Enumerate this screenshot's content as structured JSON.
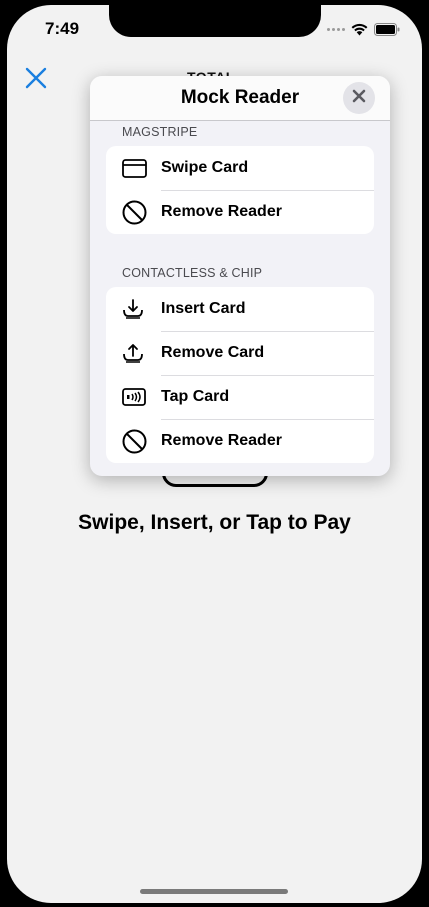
{
  "status_bar": {
    "time": "7:49",
    "wifi_icon": "wifi-icon",
    "battery_icon": "battery-icon"
  },
  "screen": {
    "close_icon": "close-icon",
    "total_peek": "TOTAL",
    "prompt": "Swipe, Insert, or Tap to Pay"
  },
  "popover": {
    "title": "Mock Reader",
    "close_icon": "close-icon",
    "sections": [
      {
        "label": "MAGSTRIPE",
        "items": [
          {
            "label": "Swipe Card",
            "icon": "credit-card-icon"
          },
          {
            "label": "Remove Reader",
            "icon": "prohibited-icon"
          }
        ]
      },
      {
        "label": "CONTACTLESS & CHIP",
        "items": [
          {
            "label": "Insert Card",
            "icon": "insert-card-icon"
          },
          {
            "label": "Remove Card",
            "icon": "remove-card-icon"
          },
          {
            "label": "Tap Card",
            "icon": "contactless-icon"
          },
          {
            "label": "Remove Reader",
            "icon": "prohibited-icon"
          }
        ]
      }
    ]
  },
  "colors": {
    "accent": "#1a7fe0",
    "background": "#f2f2f2",
    "popover_bg": "#f2f2f7"
  }
}
